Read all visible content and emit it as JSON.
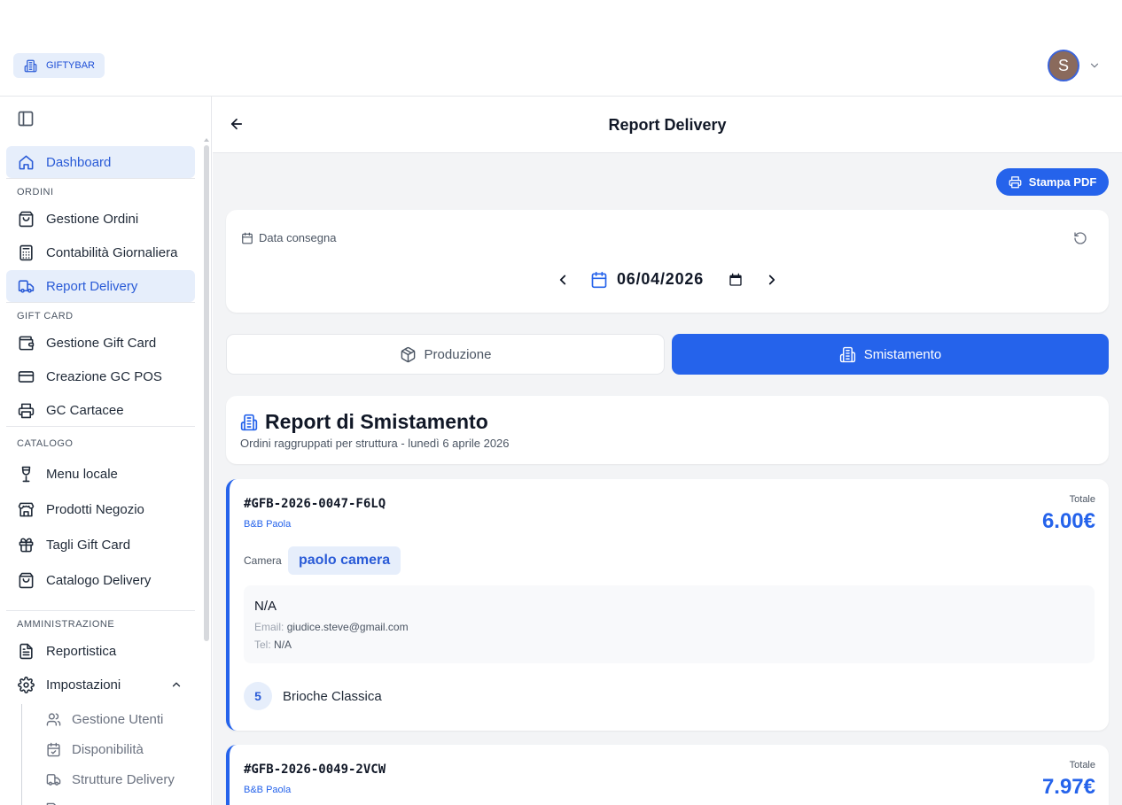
{
  "brand": {
    "name": "GIFTYBAR"
  },
  "user": {
    "initial": "S"
  },
  "sidebar": {
    "dashboard": "Dashboard",
    "sections": {
      "ordini": "ORDINI",
      "giftcard": "GIFT CARD",
      "catalogo": "CATALOGO",
      "amministrazione": "AMMINISTRAZIONE"
    },
    "items": {
      "gestione_ordini": "Gestione Ordini",
      "contabilita": "Contabilità Giornaliera",
      "report_delivery": "Report Delivery",
      "gestione_gift_card": "Gestione Gift Card",
      "creazione_gc_pos": "Creazione GC POS",
      "gc_cartacee": "GC Cartacee",
      "menu_locale": "Menu locale",
      "prodotti_negozio": "Prodotti Negozio",
      "tagli_gift_card": "Tagli Gift Card",
      "catalogo_delivery": "Catalogo Delivery",
      "reportistica": "Reportistica",
      "impostazioni": "Impostazioni"
    },
    "sub_items": {
      "gestione_utenti": "Gestione Utenti",
      "disponibilita": "Disponibilità",
      "strutture_delivery": "Strutture Delivery"
    }
  },
  "header": {
    "title": "Report Delivery"
  },
  "toolbar": {
    "print_pdf": "Stampa PDF"
  },
  "date_filter": {
    "label": "Data consegna",
    "value": "06/04/2026"
  },
  "tabs": {
    "produzione": "Produzione",
    "smistamento": "Smistamento"
  },
  "report": {
    "title": "Report di Smistamento",
    "subtitle": "Ordini raggruppati per struttura - lunedì 6 aprile 2026"
  },
  "orders": [
    {
      "code": "#GFB-2026-0047-F6LQ",
      "structure": "B&B Paola",
      "total_label": "Totale",
      "total": "6.00€",
      "room_label": "Camera",
      "room": "paolo camera",
      "customer_name": "N/A",
      "email_label": "Email:",
      "email": "giudice.steve@gmail.com",
      "tel_label": "Tel:",
      "tel": "N/A",
      "items": [
        {
          "qty": "5",
          "name": "Brioche Classica"
        }
      ]
    },
    {
      "code": "#GFB-2026-0049-2VCW",
      "structure": "B&B Paola",
      "total_label": "Totale",
      "total": "7.97€"
    }
  ],
  "colors": {
    "accent": "#2563eb",
    "active_bg": "#e6eefb"
  }
}
